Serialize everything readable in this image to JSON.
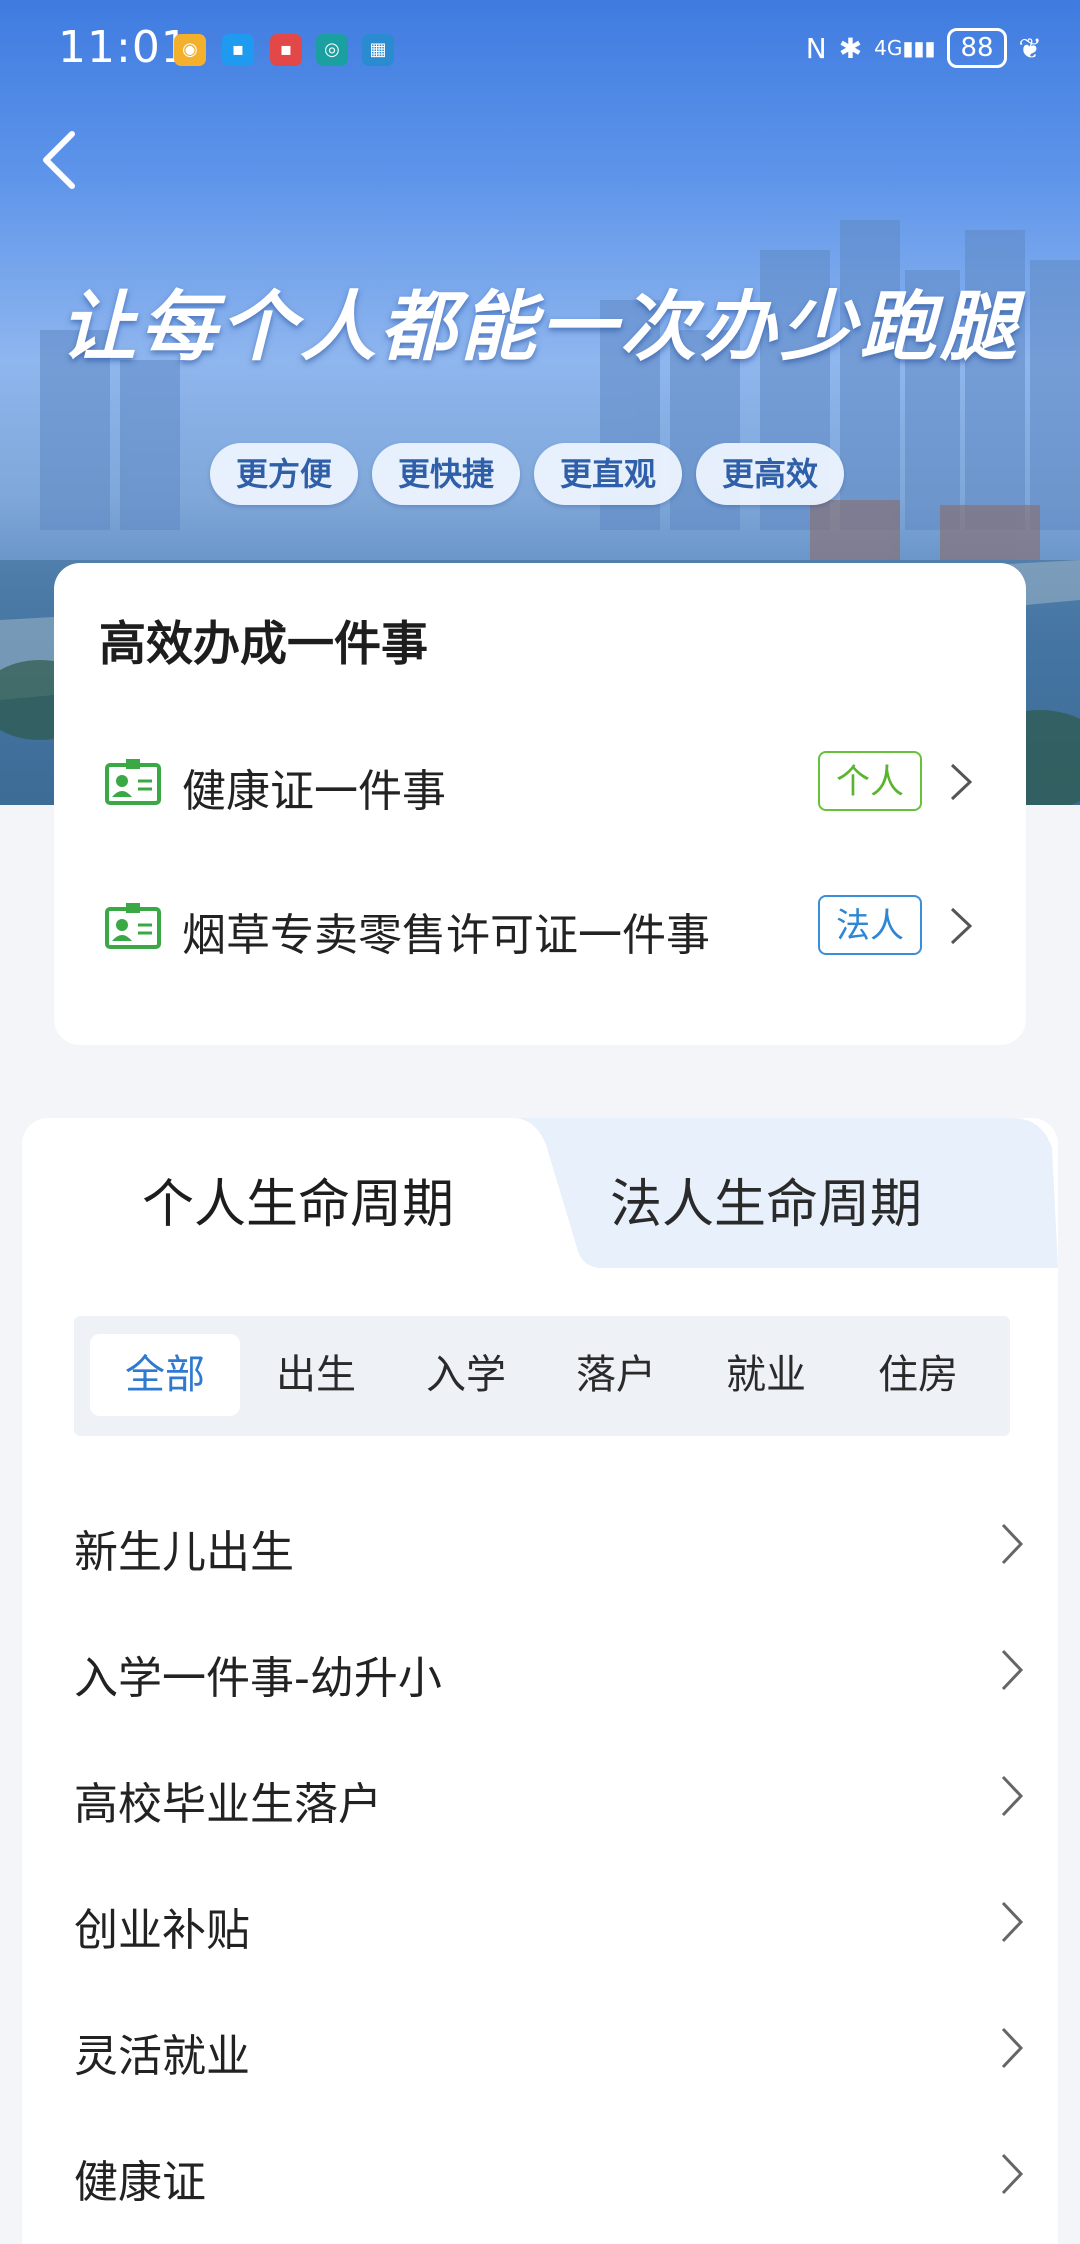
{
  "status_bar": {
    "time": "11:01",
    "battery": "88",
    "network": "4G"
  },
  "hero": {
    "slogan": "让每个人都能一次办少跑腿",
    "pills": [
      "更方便",
      "更快捷",
      "更直观",
      "更高效"
    ]
  },
  "efficient": {
    "title": "高效办成一件事",
    "items": [
      {
        "label": "健康证一件事",
        "tag": "个人",
        "tag_color": "#5bb42f"
      },
      {
        "label": "烟草专卖零售许可证一件事",
        "tag": "法人",
        "tag_color": "#2f86d4"
      }
    ]
  },
  "lifecycle": {
    "tabs": [
      "个人生命周期",
      "法人生命周期"
    ],
    "active_tab": "个人生命周期",
    "chips": [
      "全部",
      "出生",
      "入学",
      "落户",
      "就业",
      "住房"
    ],
    "active_chip": "全部",
    "items": [
      "新生儿出生",
      "入学一件事-幼升小",
      "高校毕业生落户",
      "创业补贴",
      "灵活就业",
      "健康证"
    ]
  },
  "colors": {
    "accent_blue": "#2f7ad0",
    "tag_green": "#5bb42f",
    "tab_inactive_bg": "#e8f0fb",
    "page_bg": "#f3f5f8"
  }
}
